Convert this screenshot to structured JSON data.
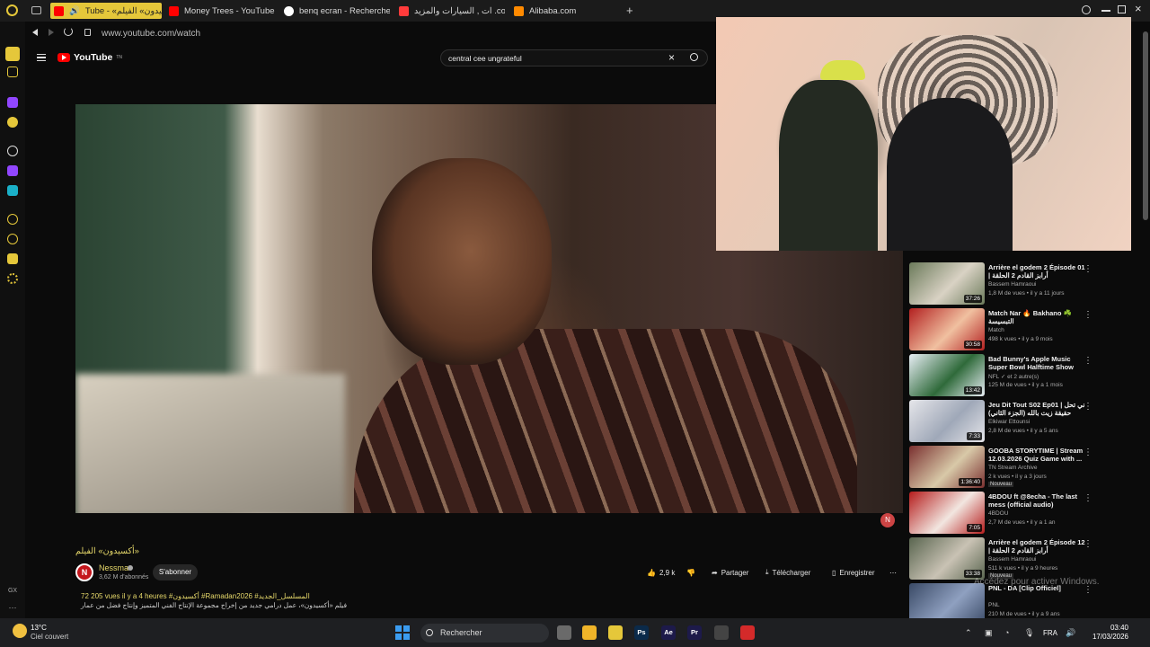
{
  "browser": {
    "tabs": [
      {
        "label": "Tube - «أكسيدون» الفيلم",
        "color": "#e5c73a"
      },
      {
        "label": "Money Trees - YouTube",
        "color": "#ff0000"
      },
      {
        "label": "benq ecran - Recherche G",
        "color": "#ffffff"
      },
      {
        "label": "ات , السيارات والمزيد .com",
        "color": "#ff3b3b"
      },
      {
        "label": "Alibaba.com",
        "color": "#ff8a00"
      }
    ],
    "new_tab": "+",
    "url": "www.youtube.com/watch"
  },
  "youtube": {
    "logo_text": "YouTube",
    "logo_sup": "TN",
    "search_value": "central cee ungrateful"
  },
  "video": {
    "title": "«أكسيدون» الفيلم",
    "channel": "Nessma",
    "channel_initial": "N",
    "subscribers": "3,62 M d'abonnés",
    "subscribe_label": "S'abonner",
    "likes": "2,9 k",
    "share_label": "Partager",
    "download_label": "Télécharger",
    "save_label": "Enregistrer",
    "desc_stats": "72 205 vues  il y a 4 heures  #أكسيدون  #Ramadan2026  #المسلسل_الجديد",
    "desc_text": "فيلم «أكسيدون»، عمل درامي جديد من إخراج مجموعة الإنتاج الفني المتميز وإنتاج فضل من عمار"
  },
  "recommendations": [
    {
      "title": "Arrière el godem 2 Épisode 01 | أرابز القادم 2 الحلقة",
      "channel": "Bassem Hamraoui",
      "meta": "1,8 M de vues • il y a 11 jours",
      "duration": "37:26",
      "new": "",
      "c1": "#6b7a5a",
      "c2": "#d9d2c4"
    },
    {
      "title": "Match Nar 🔥 Bakhano ☘️ التبسيسة",
      "channel": "Match",
      "meta": "498 k vues • il y a 9 mois",
      "duration": "30:58",
      "new": "",
      "c1": "#b32020",
      "c2": "#f0c0a0"
    },
    {
      "title": "Bad Bunny's Apple Music Super Bowl Halftime Show",
      "channel": "NFL ✓ et 2 autre(s)",
      "meta": "125 M de vues • il y a 1 mois",
      "duration": "13:42",
      "new": "",
      "c1": "#e8eef5",
      "c2": "#2f6a3a"
    },
    {
      "title": "Jeu Dit Tout S02 Ep01 | ني تحل حقيقة زيت بالله (الجزء الثاني)",
      "channel": "Elkiwar Ettounsi",
      "meta": "2,8 M de vues • il y a 5 ans",
      "duration": "7:33",
      "new": "",
      "c1": "#e6e6ea",
      "c2": "#9fa8b8"
    },
    {
      "title": "GOOBA STORYTIME | Stream 12.03.2026 Quiz Game with ...",
      "channel": "TN Stream Archive",
      "meta": "2 k vues • il y a 3 jours",
      "duration": "1:36:40",
      "new": "Nouveau",
      "c1": "#7a2f2f",
      "c2": "#d8c9a8"
    },
    {
      "title": "4BDOU ft @8echa - The last mess (official audio)",
      "channel": "4BDOU",
      "meta": "2,7 M de vues • il y a 1 an",
      "duration": "7:05",
      "new": "",
      "c1": "#b51c1c",
      "c2": "#f2e6e0"
    },
    {
      "title": "Arrière el godem 2 Épisode 12 | أرابز القادم 2 الحلقة",
      "channel": "Bassem Hamraoui",
      "meta": "511 k vues • il y a 9 heures",
      "duration": "33:38",
      "new": "Nouveau",
      "c1": "#59654f",
      "c2": "#c9c2b4"
    },
    {
      "title": "PNL - DA [Clip Officiel]",
      "channel": "PNL",
      "meta": "210 M de vues • il y a 9 ans",
      "duration": "",
      "new": "",
      "c1": "#3a4a66",
      "c2": "#8fa0c0"
    }
  ],
  "overlay": {
    "activate_windows": "Accédez pour activer Windows."
  },
  "taskbar": {
    "temperature": "13°C",
    "condition": "Ciel couvert",
    "search_label": "Rechercher",
    "lang": "FRA",
    "time": "03:40",
    "date": "17/03/2026",
    "apps": [
      {
        "label": "",
        "color": "#6a6a6a"
      },
      {
        "label": "",
        "color": "#f0b429"
      },
      {
        "label": "",
        "color": "#e5c73a"
      },
      {
        "label": "Ps",
        "color": "#0b2a4a"
      },
      {
        "label": "Ae",
        "color": "#1d1a4a"
      },
      {
        "label": "Pr",
        "color": "#1d1a4a"
      },
      {
        "label": "",
        "color": "#444444"
      },
      {
        "label": "",
        "color": "#d42a2a"
      }
    ]
  }
}
